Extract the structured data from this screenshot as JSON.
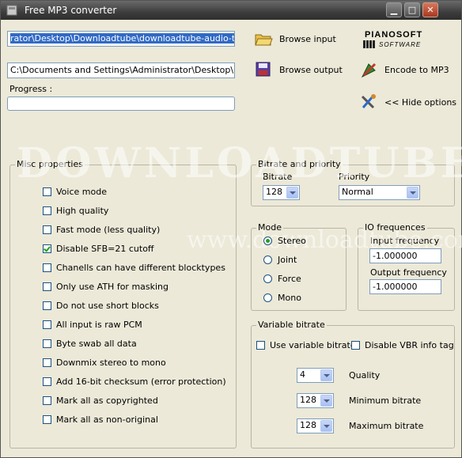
{
  "window": {
    "title": "Free MP3 converter",
    "min_symbol": "▁",
    "max_symbol": "□",
    "close_symbol": "✕"
  },
  "input_path": "rator\\Desktop\\Downloadtube\\downloadtube-audio-test.wav",
  "output_path": "C:\\Documents and Settings\\Administrator\\Desktop\\Downlo",
  "progress": {
    "label": "Progress :",
    "value": 0
  },
  "buttons": {
    "browse_input": "Browse input",
    "browse_output": "Browse output",
    "encode": "Encode to MP3",
    "hide_options": "<< Hide options"
  },
  "logo": {
    "main": "PIANOSOFT",
    "sub": "SOFTWARE"
  },
  "misc": {
    "title": "Misc properties",
    "items": [
      {
        "label": "Voice mode",
        "checked": false
      },
      {
        "label": "High quality",
        "checked": false
      },
      {
        "label": "Fast mode (less quality)",
        "checked": false
      },
      {
        "label": "Disable SFB=21 cutoff",
        "checked": true
      },
      {
        "label": "Chanells can have different blocktypes",
        "checked": false
      },
      {
        "label": "Only use ATH for masking",
        "checked": false
      },
      {
        "label": "Do not use short blocks",
        "checked": false
      },
      {
        "label": "All input is raw PCM",
        "checked": false
      },
      {
        "label": "Byte swab all data",
        "checked": false
      },
      {
        "label": "Downmix stereo to mono",
        "checked": false
      },
      {
        "label": "Add 16-bit checksum (error protection)",
        "checked": false
      },
      {
        "label": "Mark all as copyrighted",
        "checked": false
      },
      {
        "label": "Mark all as non-original",
        "checked": false
      }
    ]
  },
  "bitrate_priority": {
    "title": "Bitrate and priority",
    "bitrate_label": "Bitrate",
    "bitrate_value": "128",
    "priority_label": "Priority",
    "priority_value": "Normal"
  },
  "mode": {
    "title": "Mode",
    "options": [
      {
        "label": "Stereo",
        "selected": true
      },
      {
        "label": "Joint",
        "selected": false
      },
      {
        "label": "Force",
        "selected": false
      },
      {
        "label": "Mono",
        "selected": false
      }
    ]
  },
  "io": {
    "title": "IO frequences",
    "input_label": "Input frequency",
    "input_value": "-1.000000",
    "output_label": "Output frequency",
    "output_value": "-1.000000"
  },
  "vbr": {
    "title": "Variable bitrate",
    "use_vbr": {
      "label": "Use variable bitrate",
      "checked": false
    },
    "disable_info": {
      "label": "Disable VBR info tag",
      "checked": false
    },
    "quality": {
      "label": "Quality",
      "value": "4"
    },
    "min": {
      "label": "Minimum bitrate",
      "value": "128"
    },
    "max": {
      "label": "Maximum bitrate",
      "value": "128"
    }
  },
  "watermark": {
    "line1": "DOWNLOADTUBE",
    "line2": "www.downloadtube.com"
  },
  "colors": {
    "selection": "#316ac5",
    "check": "#21a121",
    "titlebar": "#3d3d3d",
    "close_button": "#a8391f"
  }
}
